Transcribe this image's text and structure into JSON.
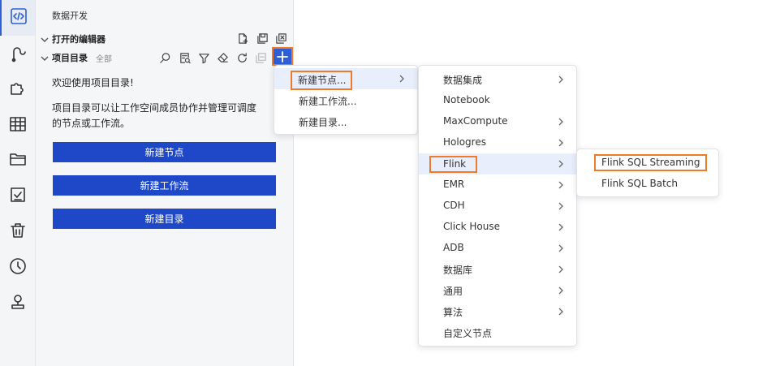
{
  "activity_bar": {
    "items": [
      {
        "name": "code-icon",
        "active": true
      },
      {
        "name": "data-integration-icon"
      },
      {
        "name": "puzzle-icon"
      },
      {
        "name": "table-icon"
      },
      {
        "name": "folder-icon"
      },
      {
        "name": "checklist-icon"
      },
      {
        "name": "trash-icon"
      },
      {
        "name": "clock-icon"
      },
      {
        "name": "stamp-icon"
      }
    ]
  },
  "panel": {
    "title": "数据开发",
    "open_editors": {
      "label": "打开的编辑器"
    },
    "project_dir": {
      "label": "项目目录",
      "filter": "全部"
    },
    "welcome_line1": "欢迎使用项目目录!",
    "welcome_line2": "项目目录可以让工作空间成员协作并管理可调度",
    "welcome_line3": "的节点或工作流。",
    "buttons": {
      "new_node": "新建节点",
      "new_workflow": "新建工作流",
      "new_dir": "新建目录"
    }
  },
  "menu1": {
    "items": [
      {
        "label": "新建节点...",
        "submenu": true
      },
      {
        "label": "新建工作流...",
        "submenu": false
      },
      {
        "label": "新建目录...",
        "submenu": false
      }
    ]
  },
  "menu2": {
    "items": [
      {
        "label": "数据集成",
        "submenu": true
      },
      {
        "label": "Notebook",
        "submenu": false
      },
      {
        "label": "MaxCompute",
        "submenu": true
      },
      {
        "label": "Hologres",
        "submenu": true
      },
      {
        "label": "Flink",
        "submenu": true
      },
      {
        "label": "EMR",
        "submenu": true
      },
      {
        "label": "CDH",
        "submenu": true
      },
      {
        "label": "Click House",
        "submenu": true
      },
      {
        "label": "ADB",
        "submenu": true
      },
      {
        "label": "数据库",
        "submenu": true
      },
      {
        "label": "通用",
        "submenu": true
      },
      {
        "label": "算法",
        "submenu": true
      },
      {
        "label": "自定义节点",
        "submenu": false
      }
    ]
  },
  "menu3": {
    "items": [
      {
        "label": "Flink SQL Streaming"
      },
      {
        "label": "Flink SQL Batch"
      }
    ]
  },
  "colors": {
    "accent": "#2f5fd6",
    "button": "#1f48c9",
    "highlight_border": "#ef7a2c"
  }
}
